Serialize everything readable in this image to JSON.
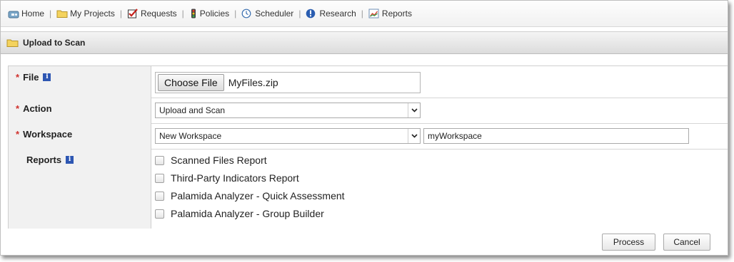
{
  "nav": {
    "items": [
      {
        "label": "Home",
        "icon": "home-icon"
      },
      {
        "label": "My Projects",
        "icon": "folder-icon"
      },
      {
        "label": "Requests",
        "icon": "checkbox-checked-icon"
      },
      {
        "label": "Policies",
        "icon": "traffic-light-icon"
      },
      {
        "label": "Scheduler",
        "icon": "clock-icon"
      },
      {
        "label": "Research",
        "icon": "info-circle-icon"
      },
      {
        "label": "Reports",
        "icon": "chart-icon"
      }
    ],
    "separator": "|"
  },
  "panel": {
    "title": "Upload to Scan",
    "icon": "folder-icon"
  },
  "form": {
    "required_mark": "*",
    "info_glyph": "i",
    "file": {
      "label": "File",
      "button_label": "Choose File",
      "file_name": "MyFiles.zip"
    },
    "action": {
      "label": "Action",
      "selected": "Upload and Scan"
    },
    "workspace": {
      "label": "Workspace",
      "selected": "New Workspace",
      "name_value": "myWorkspace"
    },
    "reports": {
      "label": "Reports",
      "options": [
        {
          "label": "Scanned Files Report",
          "checked": false
        },
        {
          "label": "Third-Party Indicators Report",
          "checked": false
        },
        {
          "label": "Palamida Analyzer - Quick Assessment",
          "checked": false
        },
        {
          "label": "Palamida Analyzer - Group Builder",
          "checked": false
        }
      ]
    }
  },
  "footer": {
    "process_label": "Process",
    "cancel_label": "Cancel"
  },
  "colors": {
    "required": "#d0312d",
    "info_badge": "#2d56b2"
  }
}
